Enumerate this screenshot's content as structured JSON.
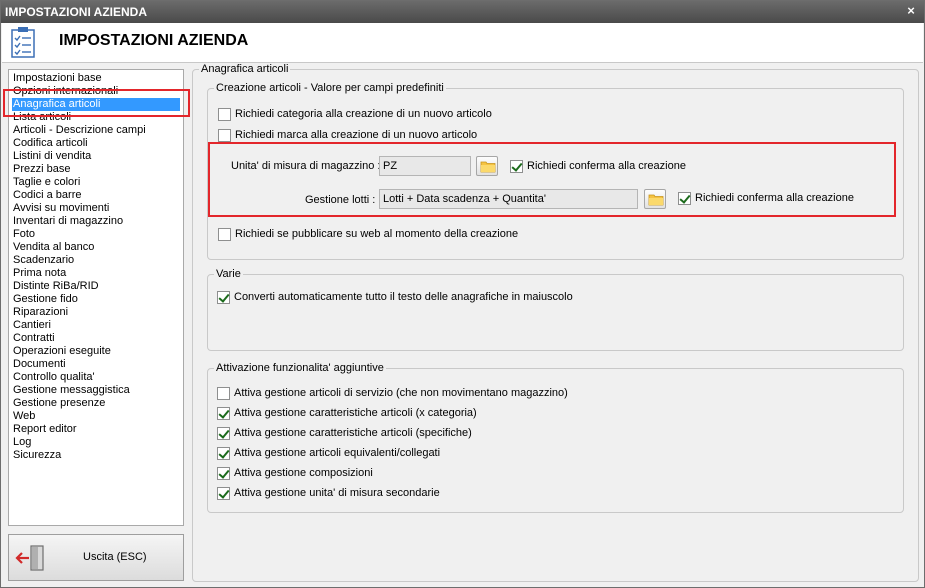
{
  "window": {
    "title": "IMPOSTAZIONI AZIENDA",
    "close_glyph": "×"
  },
  "header": {
    "title": "IMPOSTAZIONI AZIENDA",
    "icon": "checklist-icon"
  },
  "sidebar": {
    "items": [
      {
        "label": "Impostazioni base"
      },
      {
        "label": "Opzioni internazionali"
      },
      {
        "label": "Anagrafica articoli",
        "selected": true
      },
      {
        "label": "Lista articoli"
      },
      {
        "label": "Articoli - Descrizione campi"
      },
      {
        "label": "Codifica articoli"
      },
      {
        "label": "Listini di vendita"
      },
      {
        "label": "Prezzi base"
      },
      {
        "label": "Taglie e colori"
      },
      {
        "label": "Codici a barre"
      },
      {
        "label": "Avvisi su movimenti"
      },
      {
        "label": "Inventari di magazzino"
      },
      {
        "label": "Foto"
      },
      {
        "label": "Vendita al banco"
      },
      {
        "label": "Scadenzario"
      },
      {
        "label": "Prima nota"
      },
      {
        "label": "Distinte RiBa/RID"
      },
      {
        "label": "Gestione fido"
      },
      {
        "label": "Riparazioni"
      },
      {
        "label": "Cantieri"
      },
      {
        "label": "Contratti"
      },
      {
        "label": "Operazioni eseguite"
      },
      {
        "label": "Documenti"
      },
      {
        "label": "Controllo qualita'"
      },
      {
        "label": "Gestione messaggistica"
      },
      {
        "label": "Gestione presenze"
      },
      {
        "label": "Web"
      },
      {
        "label": "Report editor"
      },
      {
        "label": "Log"
      },
      {
        "label": "Sicurezza"
      }
    ]
  },
  "exit_button": {
    "label": "Uscita (ESC)",
    "icon": "exit-door-icon"
  },
  "main": {
    "outer_group_title": "Anagrafica articoli",
    "creazione": {
      "title": "Creazione articoli - Valore per campi predefiniti",
      "chk_categoria": {
        "label": "Richiedi categoria alla creazione di un nuovo articolo",
        "checked": false
      },
      "chk_marca": {
        "label": "Richiedi marca alla creazione di un nuovo articolo",
        "checked": false
      },
      "um_label": "Unita' di misura di magazzino :",
      "um_value": "PZ",
      "um_confirm": {
        "label": "Richiedi conferma alla creazione",
        "checked": true
      },
      "lotti_label": "Gestione lotti :",
      "lotti_value": "Lotti + Data scadenza + Quantita'",
      "lotti_confirm": {
        "label": "Richiedi conferma alla creazione",
        "checked": true
      },
      "chk_web": {
        "label": "Richiedi se pubblicare su web al momento della creazione",
        "checked": false
      }
    },
    "varie": {
      "title": "Varie",
      "chk_maiuscolo": {
        "label": "Converti automaticamente tutto il testo delle anagrafiche in maiuscolo",
        "checked": true
      }
    },
    "funzionalita": {
      "title": "Attivazione funzionalita' aggiuntive",
      "items": [
        {
          "label": "Attiva gestione articoli di servizio (che non movimentano magazzino)",
          "checked": false
        },
        {
          "label": "Attiva gestione caratteristiche articoli (x categoria)",
          "checked": true
        },
        {
          "label": "Attiva gestione caratteristiche articoli (specifiche)",
          "checked": true
        },
        {
          "label": "Attiva gestione articoli equivalenti/collegati",
          "checked": true
        },
        {
          "label": "Attiva gestione composizioni",
          "checked": true
        },
        {
          "label": "Attiva gestione unita' di misura secondarie",
          "checked": true
        }
      ]
    }
  },
  "colors": {
    "selection": "#3399ff",
    "highlight_box": "#e3262b",
    "titlebar": "#5a5a5a"
  }
}
